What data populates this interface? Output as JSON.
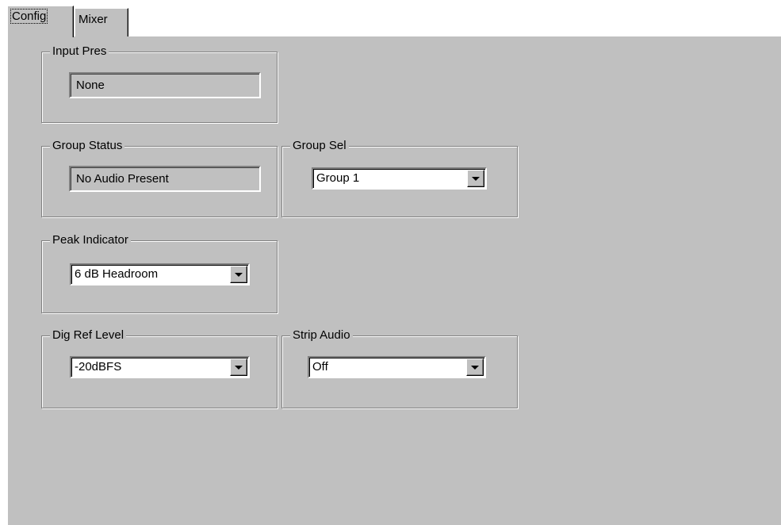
{
  "tabs": {
    "config": "Config",
    "mixer": "Mixer"
  },
  "input_pres": {
    "legend": "Input Pres",
    "value": "None"
  },
  "group_status": {
    "legend": "Group Status",
    "value": "No Audio Present"
  },
  "group_sel": {
    "legend": "Group Sel",
    "value": "Group 1"
  },
  "peak_indicator": {
    "legend": "Peak Indicator",
    "value": "6 dB Headroom"
  },
  "dig_ref_level": {
    "legend": "Dig Ref Level",
    "value": "-20dBFS"
  },
  "strip_audio": {
    "legend": "Strip Audio",
    "value": "Off"
  },
  "icons": {
    "dropdown": "chevron-down-icon"
  }
}
